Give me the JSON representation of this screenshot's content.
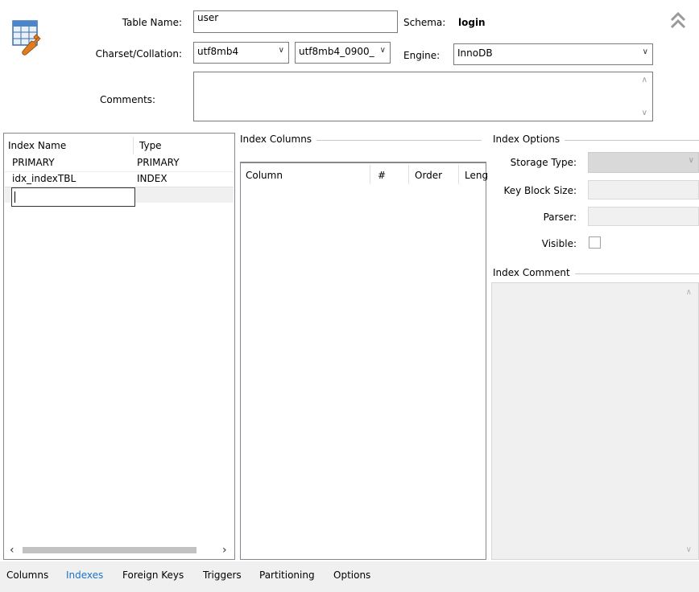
{
  "header": {
    "table_name_label": "Table Name:",
    "table_name_value": "user",
    "schema_label": "Schema:",
    "schema_value": "login",
    "charset_label": "Charset/Collation:",
    "charset_value": "utf8mb4",
    "collation_value": "utf8mb4_0900_",
    "engine_label": "Engine:",
    "engine_value": "InnoDB",
    "comments_label": "Comments:"
  },
  "index_list": {
    "headers": [
      "Index Name",
      "Type"
    ],
    "rows": [
      {
        "name": "PRIMARY",
        "type": "PRIMARY"
      },
      {
        "name": "idx_indexTBL",
        "type": "INDEX"
      }
    ]
  },
  "index_columns": {
    "title": "Index Columns",
    "headers": [
      "Column",
      "#",
      "Order",
      "Leng"
    ]
  },
  "index_options": {
    "title": "Index Options",
    "storage_type_label": "Storage Type:",
    "key_block_size_label": "Key Block Size:",
    "parser_label": "Parser:",
    "visible_label": "Visible:",
    "comment_title": "Index Comment"
  },
  "tabs": {
    "columns": "Columns",
    "indexes": "Indexes",
    "foreign_keys": "Foreign Keys",
    "triggers": "Triggers",
    "partitioning": "Partitioning",
    "options": "Options"
  },
  "colors": {
    "active_tab": "#1a73c9",
    "tab_bar": "#f0f0f0",
    "border": "#828790"
  },
  "icons": [
    "table-wrench-icon",
    "collapse-up-icon"
  ]
}
